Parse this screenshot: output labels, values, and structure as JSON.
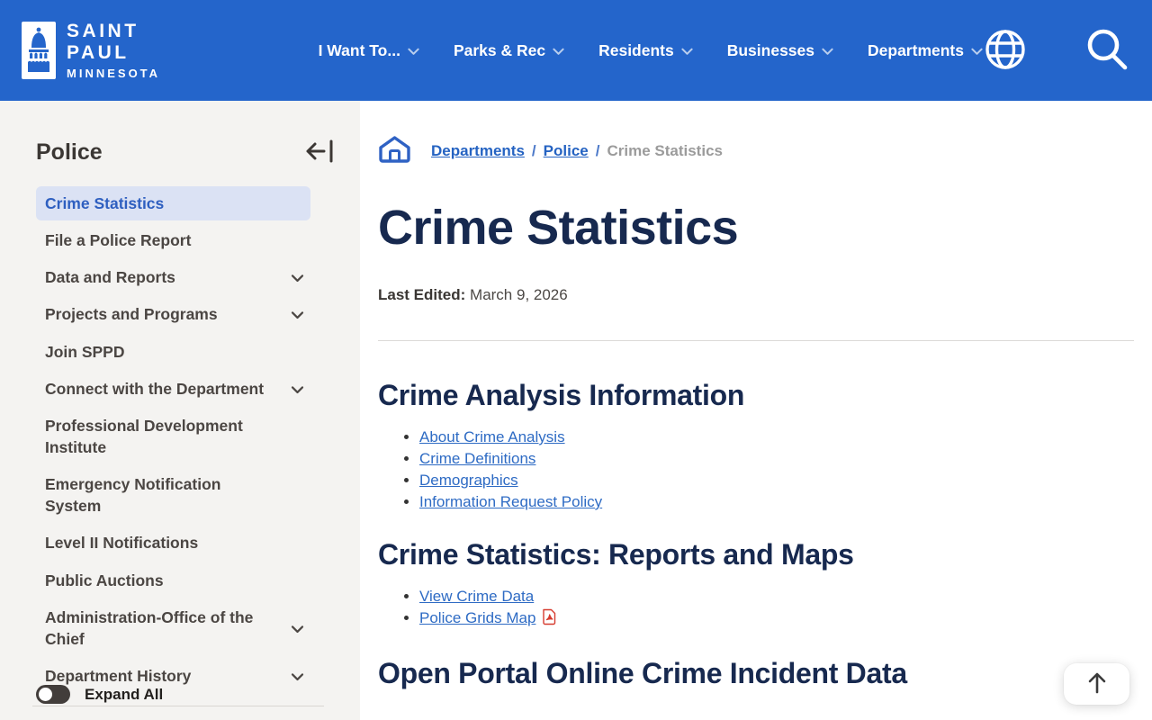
{
  "header": {
    "logo": {
      "line1": "SAINT PAUL",
      "line2": "MINNESOTA"
    },
    "nav": [
      {
        "label": "I Want To..."
      },
      {
        "label": "Parks & Rec"
      },
      {
        "label": "Residents"
      },
      {
        "label": "Businesses"
      },
      {
        "label": "Departments"
      }
    ],
    "background_color": "#2465cb"
  },
  "sidebar": {
    "title": "Police",
    "items": [
      {
        "label": "Crime Statistics",
        "active": true,
        "expandable": false
      },
      {
        "label": "File a Police Report",
        "active": false,
        "expandable": false
      },
      {
        "label": "Data and Reports",
        "active": false,
        "expandable": true
      },
      {
        "label": "Projects and Programs",
        "active": false,
        "expandable": true
      },
      {
        "label": "Join SPPD",
        "active": false,
        "expandable": false
      },
      {
        "label": "Connect with the Department",
        "active": false,
        "expandable": true
      },
      {
        "label": "Professional Development Institute",
        "active": false,
        "expandable": false
      },
      {
        "label": "Emergency Notification System",
        "active": false,
        "expandable": false
      },
      {
        "label": "Level II Notifications",
        "active": false,
        "expandable": false
      },
      {
        "label": "Public Auctions",
        "active": false,
        "expandable": false
      },
      {
        "label": "Administration-Office of the Chief",
        "active": false,
        "expandable": true
      },
      {
        "label": "Department History",
        "active": false,
        "expandable": true
      }
    ],
    "expand_all_label": "Expand All",
    "expand_all_state": "off"
  },
  "breadcrumb": [
    {
      "label": "Departments",
      "link": true
    },
    {
      "label": "Police",
      "link": true
    },
    {
      "label": "Crime Statistics",
      "link": false
    }
  ],
  "main": {
    "title": "Crime Statistics",
    "last_edited_label": "Last Edited:",
    "last_edited_date": "March 9, 2026",
    "sections": [
      {
        "heading": "Crime Analysis Information",
        "links": [
          {
            "label": "About Crime Analysis",
            "pdf": false
          },
          {
            "label": "Crime Definitions",
            "pdf": false
          },
          {
            "label": "Demographics",
            "pdf": false
          },
          {
            "label": "Information Request Policy",
            "pdf": false
          }
        ]
      },
      {
        "heading": "Crime Statistics: Reports and Maps",
        "links": [
          {
            "label": "View Crime Data",
            "pdf": false
          },
          {
            "label": "Police Grids Map",
            "pdf": true
          }
        ]
      },
      {
        "heading": "Open Portal Online Crime Incident Data",
        "links": []
      }
    ]
  },
  "colors": {
    "header_blue": "#2465cb",
    "heading_navy": "#17294f",
    "link_blue": "#2e6bc4",
    "active_item_bg": "#dbe2f4",
    "active_item_text": "#2e5fc0",
    "sidebar_bg": "#f4f3f1",
    "pdf_red": "#d63b2f"
  }
}
